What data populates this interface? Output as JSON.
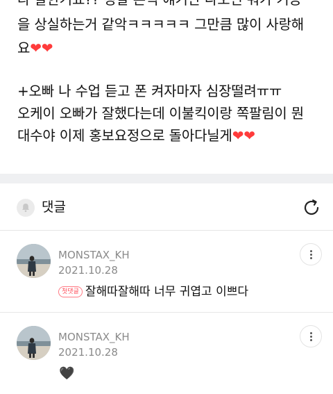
{
  "post": {
    "line0": "다 잘한거죠?? 정말 본떡 얘기만 나오면 뭐가 기능",
    "line1": "을 상실하는거 같악ㅋㅋㅋㅋㅋ 그만큼 많이 사랑해",
    "line2": "요",
    "line3": "+오빠 나 수업 듣고 폰 켜자마자 심장떨려ㅠㅠ",
    "line4": "오케이 오빠가 잘했다는데 이불킥이랑 쪽팔림이 뭔",
    "line5": "대수야 이제 홍보요정으로 돌아다닐게",
    "heart": "❤"
  },
  "comments_section": {
    "title": "댓글",
    "bell_icon": "bell-icon",
    "refresh_icon": "refresh-icon"
  },
  "comments": [
    {
      "author": "MONSTAX_KH",
      "date": "2021.10.28",
      "badge": "첫댓글",
      "text": "잘해따잘해따 너무 귀엽고 이쁘다"
    },
    {
      "author": "MONSTAX_KH",
      "date": "2021.10.28",
      "text": "🖤"
    }
  ],
  "colors": {
    "heart": "#ff3b3b",
    "badge": "#ff4d5a",
    "meta_text": "#8a8a8a",
    "section_gap": "#eff0f2"
  }
}
